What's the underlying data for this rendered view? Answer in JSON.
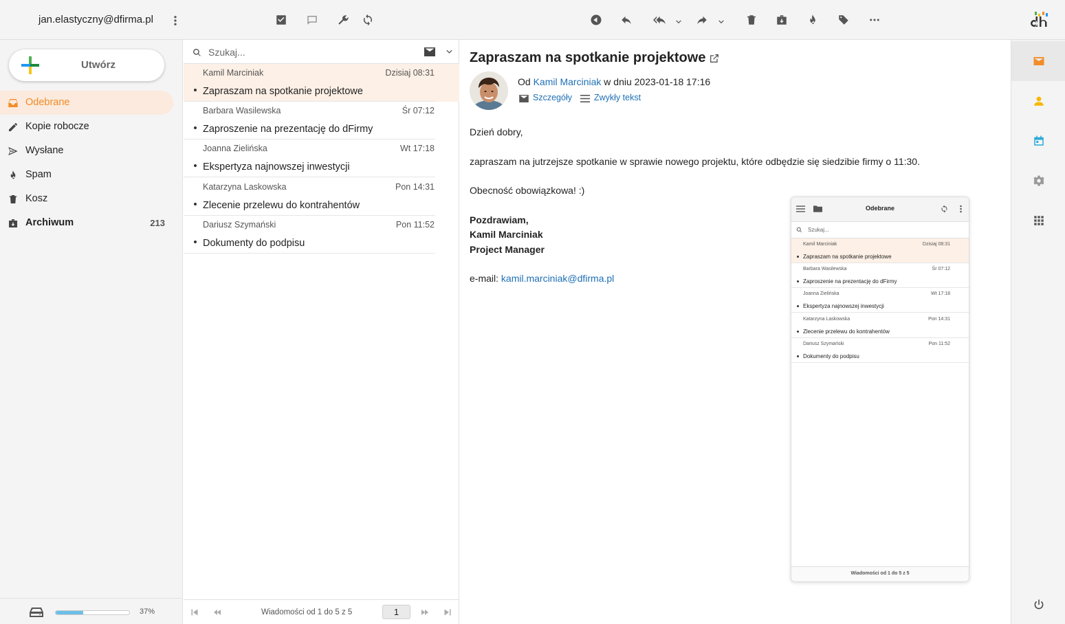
{
  "header": {
    "account": "jan.elastyczny@dfirma.pl"
  },
  "sidebar": {
    "compose_label": "Utwórz",
    "folders": [
      {
        "label": "Odebrane",
        "icon": "inbox-icon",
        "active": true
      },
      {
        "label": "Kopie robocze",
        "icon": "pencil-icon"
      },
      {
        "label": "Wysłane",
        "icon": "send-icon"
      },
      {
        "label": "Spam",
        "icon": "fire-icon"
      },
      {
        "label": "Kosz",
        "icon": "trash-icon"
      },
      {
        "label": "Archiwum",
        "icon": "archive-icon",
        "count": "213"
      }
    ],
    "quota": {
      "percent_label": "37%",
      "fraction": 0.37
    }
  },
  "list": {
    "search_placeholder": "Szukaj...",
    "messages": [
      {
        "from": "Kamil Marciniak",
        "date": "Dzisiaj 08:31",
        "subject": "Zapraszam na spotkanie projektowe",
        "selected": true
      },
      {
        "from": "Barbara Wasilewska",
        "date": "Śr 07:12",
        "subject": "Zaproszenie na prezentację do dFirmy"
      },
      {
        "from": "Joanna Zielińska",
        "date": "Wt 17:18",
        "subject": "Ekspertyza najnowszej inwestycji"
      },
      {
        "from": "Katarzyna Laskowska",
        "date": "Pon 14:31",
        "subject": "Zlecenie przelewu do kontrahentów"
      },
      {
        "from": "Dariusz Szymański",
        "date": "Pon 11:52",
        "subject": "Dokumenty do podpisu"
      }
    ],
    "pager": {
      "info": "Wiadomości od 1 do 5 z 5",
      "page": "1"
    }
  },
  "reader": {
    "subject": "Zapraszam na spotkanie projektowe",
    "from_prefix": "Od",
    "from_name": "Kamil Marciniak",
    "from_suffix": "w dniu 2023-01-18 17:16",
    "details_label": "Szczegóły",
    "plaintext_label": "Zwykły tekst",
    "body": {
      "greeting": "Dzień dobry,",
      "line1": "zapraszam na jutrzejsze spotkanie w sprawie nowego projektu, które odbędzie się siedzibie firmy o 11:30.",
      "line2": "Obecność obowiązkowa! :)",
      "sig1": "Pozdrawiam,",
      "sig2": "Kamil Marciniak",
      "sig3": "Project Manager",
      "email_prefix": "e-mail:",
      "email": "kamil.marciniak@dfirma.pl"
    },
    "embedded_image": {
      "title": "Odebrane",
      "search_placeholder": "Szukaj...",
      "footer": "Wiadomości od 1 do 5 z 5"
    }
  },
  "colors": {
    "accent": "#f28c28",
    "link": "#1e6fb5",
    "selected_bg": "#fdf0e6"
  }
}
